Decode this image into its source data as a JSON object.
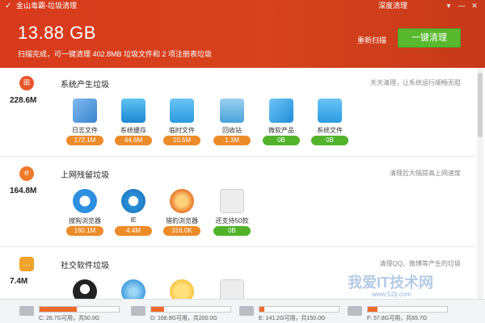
{
  "window": {
    "title": "金山毒霸-垃圾清理",
    "deep_clean": "深度清理",
    "menu_icon": "menu-icon",
    "minimize_icon": "minimize-icon",
    "close_icon": "close-icon"
  },
  "summary": {
    "total_size": "13.88 GB",
    "scan_text": "扫描完成，可一键清理 402.8MB 垃圾文件和 2 项注册表垃圾",
    "rescan": "重新扫描",
    "clean_button": "一键清理"
  },
  "sections": [
    {
      "icon": "windows-icon",
      "size": "228.6M",
      "title": "系统产生垃圾",
      "desc": "天天清理，让系统运行顺畅无阻",
      "items": [
        {
          "label": "日志文件",
          "value": "172.1M",
          "status": "orange",
          "icon": "log-file-icon"
        },
        {
          "label": "系统缓存",
          "value": "44.6M",
          "status": "orange",
          "icon": "system-cache-icon"
        },
        {
          "label": "临时文件",
          "value": "10.5M",
          "status": "orange",
          "icon": "temp-folder-icon"
        },
        {
          "label": "回收站",
          "value": "1.3M",
          "status": "orange",
          "icon": "recycle-bin-icon"
        },
        {
          "label": "微软产品",
          "value": "0B",
          "status": "green",
          "icon": "windows-logo-icon"
        },
        {
          "label": "系统文件",
          "value": "0B",
          "status": "green",
          "icon": "system-folder-icon"
        }
      ]
    },
    {
      "icon": "internet-icon",
      "size": "164.8M",
      "title": "上网残留垃圾",
      "desc": "清理后大幅提高上网速度",
      "items": [
        {
          "label": "搜狗浏览器",
          "value": "160.1M",
          "status": "orange",
          "icon": "sogou-browser-icon"
        },
        {
          "label": "IE",
          "value": "4.4M",
          "status": "orange",
          "icon": "ie-icon"
        },
        {
          "label": "猎豹浏览器",
          "value": "316.0K",
          "status": "orange",
          "icon": "cheetah-browser-icon"
        },
        {
          "label": "还支持50款",
          "value": "0B",
          "status": "green",
          "icon": "more-apps-icon"
        }
      ]
    },
    {
      "icon": "chat-icon",
      "size": "7.4M",
      "title": "社交软件垃圾",
      "desc": "清理QQ、微博等产生的垃圾",
      "items": [
        {
          "label": "",
          "value": "",
          "status": "",
          "icon": "qq-penguin-icon"
        },
        {
          "label": "",
          "value": "",
          "status": "",
          "icon": "chat-bubble-icon"
        },
        {
          "label": "",
          "value": "",
          "status": "",
          "icon": "emoticon-icon"
        },
        {
          "label": "",
          "value": "",
          "status": "",
          "icon": "more-apps-icon"
        }
      ]
    }
  ],
  "drives": [
    {
      "text": "C: 26.7G可用，共50.0G",
      "used_fraction": 0.47
    },
    {
      "text": "D: 168.9G可用，共200.0G",
      "used_fraction": 0.16
    },
    {
      "text": "E: 141.2G可用，共150.0G",
      "used_fraction": 0.06
    },
    {
      "text": "F: 57.8G可用，共65.7G",
      "used_fraction": 0.12
    }
  ],
  "watermark": {
    "text": "我爱IT技术网",
    "url": "www.52ij.com"
  },
  "colors": {
    "header_bg": "#d83a1c",
    "clean_btn": "#58b82e",
    "badge_orange": "#ec8b2a",
    "badge_green": "#52b32b"
  }
}
